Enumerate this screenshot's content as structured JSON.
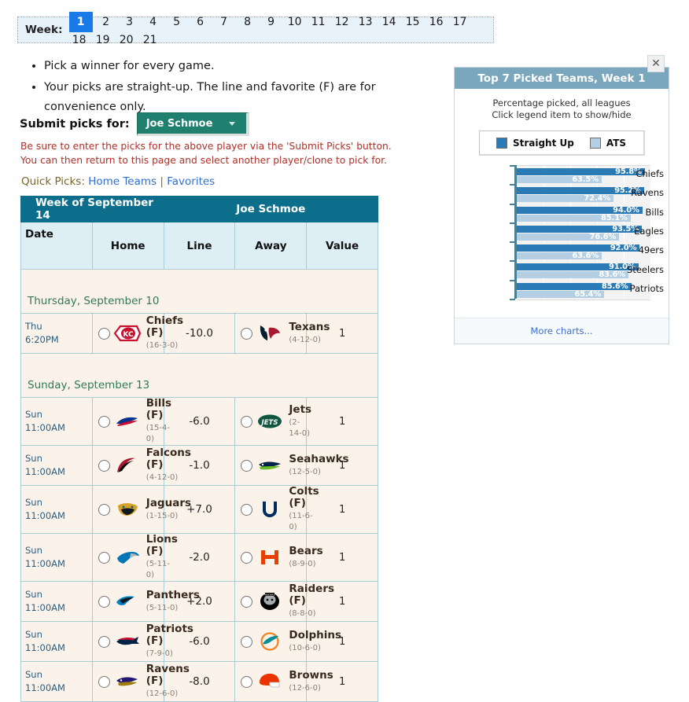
{
  "week_selector": {
    "label": "Week:",
    "weeks": [
      "1",
      "2",
      "3",
      "4",
      "5",
      "6",
      "7",
      "8",
      "9",
      "10",
      "11",
      "12",
      "13",
      "14",
      "15",
      "16",
      "17",
      "18",
      "19",
      "20",
      "21"
    ],
    "active": "1"
  },
  "notes": [
    "Pick a winner for every game.",
    "Your picks are straight-up. The line and favorite (F) are for convenience only."
  ],
  "submit": {
    "label": "Submit picks for:",
    "player": "Joe Schmoe",
    "warning_1": "Be sure to enter the picks for the above player via the 'Submit Picks' button.",
    "warning_2": "You can then return to this page and select another player/clone to pick for."
  },
  "quick_picks": {
    "label": "Quick Picks:",
    "home_teams": "Home Teams",
    "separator": "|",
    "favorites": "Favorites"
  },
  "games_table": {
    "title_left": "Week of September 14",
    "title_right": "Joe Schmoe",
    "columns": [
      "Date",
      "Home",
      "Line",
      "Away",
      "Value"
    ],
    "sections": [
      {
        "header": "Thursday, September 10",
        "rows": [
          {
            "day": "Thu",
            "time": "6:20PM",
            "home": {
              "name": "Chiefs (F)",
              "record": "(16-3-0)",
              "logo": "chiefs"
            },
            "line": "-10.0",
            "away": {
              "name": "Texans",
              "record": "(4-12-0)",
              "logo": "texans"
            },
            "value": "1"
          }
        ]
      },
      {
        "header": "Sunday, September 13",
        "rows": [
          {
            "day": "Sun",
            "time": "11:00AM",
            "home": {
              "name": "Bills (F)",
              "record": "(15-4-0)",
              "logo": "bills"
            },
            "line": "-6.0",
            "away": {
              "name": "Jets",
              "record": "(2-14-0)",
              "logo": "jets"
            },
            "value": "1"
          },
          {
            "day": "Sun",
            "time": "11:00AM",
            "home": {
              "name": "Falcons (F)",
              "record": "(4-12-0)",
              "logo": "falcons"
            },
            "line": "-1.0",
            "away": {
              "name": "Seahawks",
              "record": "(12-5-0)",
              "logo": "seahawks"
            },
            "value": "1"
          },
          {
            "day": "Sun",
            "time": "11:00AM",
            "home": {
              "name": "Jaguars",
              "record": "(1-15-0)",
              "logo": "jaguars"
            },
            "line": "+7.0",
            "away": {
              "name": "Colts (F)",
              "record": "(11-6-0)",
              "logo": "colts"
            },
            "value": "1"
          },
          {
            "day": "Sun",
            "time": "11:00AM",
            "home": {
              "name": "Lions (F)",
              "record": "(5-11-0)",
              "logo": "lions"
            },
            "line": "-2.0",
            "away": {
              "name": "Bears",
              "record": "(8-9-0)",
              "logo": "bears"
            },
            "value": "1"
          },
          {
            "day": "Sun",
            "time": "11:00AM",
            "home": {
              "name": "Panthers",
              "record": "(5-11-0)",
              "logo": "panthers"
            },
            "line": "+2.0",
            "away": {
              "name": "Raiders (F)",
              "record": "(8-8-0)",
              "logo": "raiders"
            },
            "value": "1"
          },
          {
            "day": "Sun",
            "time": "11:00AM",
            "home": {
              "name": "Patriots (F)",
              "record": "(7-9-0)",
              "logo": "patriots"
            },
            "line": "-6.0",
            "away": {
              "name": "Dolphins",
              "record": "(10-6-0)",
              "logo": "dolphins"
            },
            "value": "1"
          },
          {
            "day": "Sun",
            "time": "11:00AM",
            "home": {
              "name": "Ravens (F)",
              "record": "(12-6-0)",
              "logo": "ravens"
            },
            "line": "-8.0",
            "away": {
              "name": "Browns",
              "record": "(12-6-0)",
              "logo": "browns"
            },
            "value": "1"
          }
        ]
      }
    ]
  },
  "chart_panel": {
    "close_icon": "close-icon",
    "title": "Top 7 Picked Teams, Week 1",
    "subtitle_line_1": "Percentage picked, all leagues",
    "subtitle_line_2": "Click legend item to show/hide",
    "legend": [
      {
        "label": "Straight Up",
        "color": "#2a7ab5"
      },
      {
        "label": "ATS",
        "color": "#b4cfe3"
      }
    ],
    "footer_link": "More charts..."
  },
  "chart_data": {
    "type": "bar",
    "orientation": "horizontal",
    "title": "Top 7 Picked Teams, Week 1",
    "subtitle": "Percentage picked, all leagues",
    "xlabel": "",
    "ylabel": "",
    "xlim": [
      0,
      100
    ],
    "grid": true,
    "legend_position": "top",
    "categories": [
      "Chiefs",
      "Ravens",
      "Bills",
      "Eagles",
      "49ers",
      "Steelers",
      "Patriots"
    ],
    "series": [
      {
        "name": "Straight Up",
        "color": "#2a7ab5",
        "values": [
          95.8,
          95.2,
          94.0,
          93.5,
          92.0,
          91.0,
          85.6
        ],
        "labels": [
          "95.8%",
          "95.2%",
          "94.0%",
          "93.5%",
          "92.0%",
          "91.0%",
          "85.6%"
        ]
      },
      {
        "name": "ATS",
        "color": "#b4cfe3",
        "values": [
          63.5,
          72.4,
          85.1,
          76.6,
          63.6,
          83.6,
          65.4
        ],
        "labels": [
          "63.5%",
          "72.4%",
          "85.1%",
          "76.6%",
          "63.6%",
          "83.6%",
          "65.4%"
        ]
      }
    ]
  }
}
